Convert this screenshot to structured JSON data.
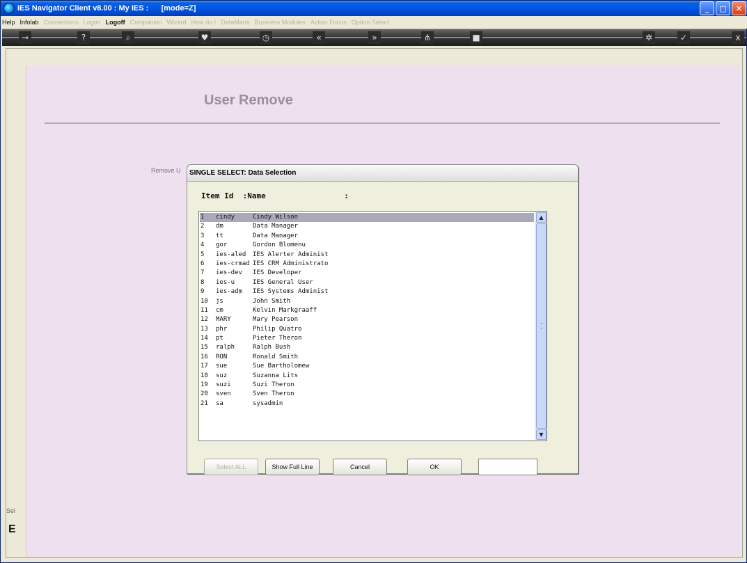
{
  "window": {
    "title": "IES Navigator Client v8.00 : My IES :      [mode=Z]",
    "controls": {
      "minimize": "_",
      "maximize": "□",
      "close": "✕"
    }
  },
  "menu": {
    "items": [
      {
        "label": "Help",
        "state": "on"
      },
      {
        "label": "Infolab",
        "state": "on"
      },
      {
        "label": "Connections",
        "state": "off"
      },
      {
        "label": "Logon",
        "state": "off"
      },
      {
        "label": "Logoff",
        "state": "bold"
      },
      {
        "label": "Companion",
        "state": "off"
      },
      {
        "label": "Wizard",
        "state": "off"
      },
      {
        "label": "How do I",
        "state": "off"
      },
      {
        "label": "DataMarts",
        "state": "off"
      },
      {
        "label": "Business Modules",
        "state": "off"
      },
      {
        "label": "Action Focus",
        "state": "off"
      },
      {
        "label": "Option Select",
        "state": "off"
      }
    ]
  },
  "toolbar": {
    "icons": [
      {
        "name": "key-icon",
        "glyph": "⊸"
      },
      {
        "name": "help-icon",
        "glyph": "?"
      },
      {
        "name": "search-icon",
        "glyph": "⌕"
      },
      {
        "name": "heart-icon",
        "glyph": "♥"
      },
      {
        "name": "clock-icon",
        "glyph": "◷"
      },
      {
        "name": "rewind-icon",
        "glyph": "«"
      },
      {
        "name": "fast-forward-icon",
        "glyph": "»"
      },
      {
        "name": "tree-icon",
        "glyph": "⋔"
      },
      {
        "name": "square-icon",
        "glyph": "■"
      },
      {
        "name": "settings-icon",
        "glyph": "✲"
      },
      {
        "name": "check-icon",
        "glyph": "✓"
      },
      {
        "name": "close-circle-icon",
        "glyph": "x"
      }
    ]
  },
  "page": {
    "title": "User Remove",
    "remove_label": "Remove U",
    "side_fragment_1": "Sel",
    "side_fragment_2": "E"
  },
  "dialog": {
    "title": "SINGLE SELECT: Data Selection",
    "col_header": "Item Id  :Name                 :",
    "rows": [
      {
        "num": "1",
        "id": "cindy",
        "name": "Cindy Wilson",
        "selected": true
      },
      {
        "num": "2",
        "id": "dm",
        "name": "Data Manager"
      },
      {
        "num": "3",
        "id": "tt",
        "name": "Data Manager"
      },
      {
        "num": "4",
        "id": "gor",
        "name": "Gordon Blomenu"
      },
      {
        "num": "5",
        "id": "ies-aled",
        "name": "IES Alerter Administ"
      },
      {
        "num": "6",
        "id": "ies-crmad",
        "name": "IES CRM Administrato"
      },
      {
        "num": "7",
        "id": "ies-dev",
        "name": "IES Developer"
      },
      {
        "num": "8",
        "id": "ies-u",
        "name": "IES General User"
      },
      {
        "num": "9",
        "id": "ies-adm",
        "name": "IES Systems Administ"
      },
      {
        "num": "10",
        "id": "js",
        "name": "John Smith"
      },
      {
        "num": "11",
        "id": "cm",
        "name": "Kelvin Markgraaff"
      },
      {
        "num": "12",
        "id": "MARY",
        "name": "Mary Pearson"
      },
      {
        "num": "13",
        "id": "phr",
        "name": "Philip Quatro"
      },
      {
        "num": "14",
        "id": "pt",
        "name": "Pieter Theron"
      },
      {
        "num": "15",
        "id": "ralph",
        "name": "Ralph Bush"
      },
      {
        "num": "16",
        "id": "RON",
        "name": "Ronald Smith"
      },
      {
        "num": "17",
        "id": "sue",
        "name": "Sue Bartholomew"
      },
      {
        "num": "18",
        "id": "suz",
        "name": "Suzanna Lits"
      },
      {
        "num": "19",
        "id": "suzi",
        "name": "Suzi Theron"
      },
      {
        "num": "20",
        "id": "sven",
        "name": "Sven Theron"
      },
      {
        "num": "21",
        "id": "sa",
        "name": "sysadmin"
      }
    ],
    "buttons": {
      "select_all": "Select ALL",
      "show_full_line": "Show Full Line",
      "cancel": "Cancel",
      "ok": "OK"
    },
    "input_value": ""
  }
}
